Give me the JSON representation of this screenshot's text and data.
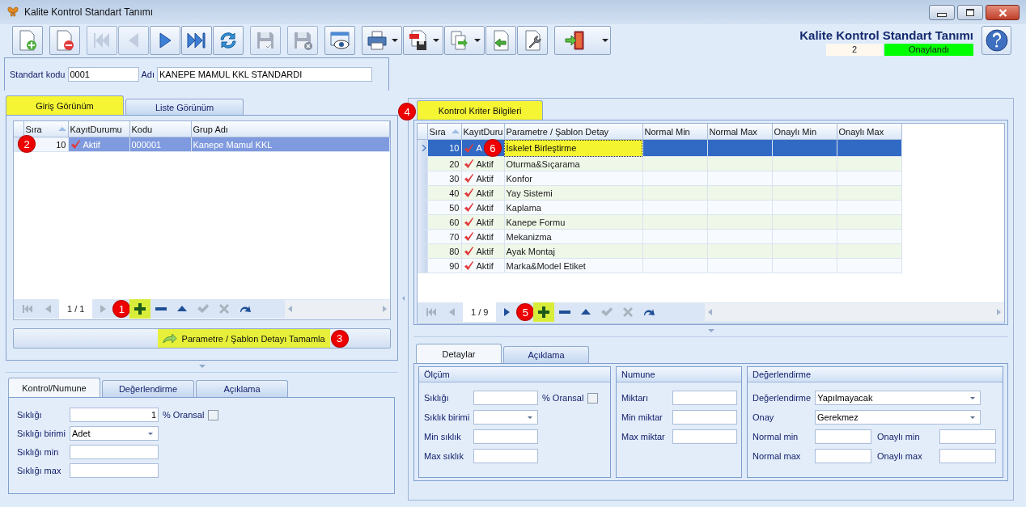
{
  "window": {
    "title": "Kalite Kontrol Standart Tanımı"
  },
  "toolbar": {
    "groups": [
      [
        {
          "kind": "new",
          "disabled": false
        }
      ],
      [
        {
          "kind": "delete",
          "disabled": false
        }
      ],
      [
        {
          "kind": "first",
          "disabled": true
        },
        {
          "kind": "prev",
          "disabled": true
        },
        {
          "kind": "next",
          "disabled": false
        },
        {
          "kind": "last",
          "disabled": false
        },
        {
          "kind": "refresh",
          "disabled": false
        }
      ],
      [
        {
          "kind": "save",
          "disabled": true
        }
      ],
      [
        {
          "kind": "discard",
          "disabled": true
        }
      ],
      [
        {
          "kind": "preview",
          "disabled": false
        }
      ],
      [
        {
          "kind": "print",
          "disabled": false,
          "dropdown": true
        },
        {
          "kind": "pdf",
          "disabled": false,
          "dropdown": true
        },
        {
          "kind": "export",
          "disabled": false,
          "dropdown": true
        },
        {
          "kind": "import",
          "disabled": false
        },
        {
          "kind": "tools",
          "disabled": false
        }
      ],
      [
        {
          "kind": "exit",
          "disabled": false,
          "dropdown": true
        }
      ]
    ]
  },
  "header": {
    "title": "Kalite Kontrol Standart Tanımı",
    "record_no": "2",
    "status": "Onaylandı"
  },
  "form": {
    "code_label": "Standart kodu",
    "code_value": "0001",
    "name_label": "Adı",
    "name_value": "KANEPE MAMUL KKL STANDARDI"
  },
  "left_tabs": [
    {
      "label": "Giriş Görünüm",
      "selected": true
    },
    {
      "label": "Liste Görünüm",
      "selected": false
    }
  ],
  "left_grid": {
    "columns": [
      "Sıra",
      "KayıtDurumu",
      "Kodu",
      "Grup Adı"
    ],
    "rows": [
      {
        "sira": "10",
        "status": "Aktif",
        "code": "000001",
        "group": "Kanepe Mamul KKL",
        "selected": true,
        "badge": "2"
      }
    ],
    "navigator": [
      {
        "kind": "first",
        "disabled": true
      },
      {
        "kind": "prev",
        "disabled": true
      },
      {
        "kind": "page",
        "label": "1 / 1"
      },
      {
        "kind": "next",
        "disabled": true
      },
      {
        "kind": "badge",
        "label": "1"
      },
      {
        "kind": "add",
        "disabled": false,
        "highlighted": true
      },
      {
        "kind": "remove",
        "disabled": false
      },
      {
        "kind": "up",
        "disabled": false
      },
      {
        "kind": "check",
        "disabled": true
      },
      {
        "kind": "cancel",
        "disabled": true
      },
      {
        "kind": "redo",
        "disabled": false
      }
    ]
  },
  "complete_button": {
    "label": "Parametre / Şablon Detayı Tamamla",
    "badge": "3"
  },
  "left_detail": {
    "tabs": [
      {
        "label": "Kontrol/Numune",
        "selected": true
      },
      {
        "label": "Değerlendirme",
        "selected": false
      },
      {
        "label": "Açıklama",
        "selected": false
      }
    ],
    "fields": [
      {
        "label": "Sıklığı",
        "kind": "number",
        "value": "1",
        "check": {
          "label": "% Oransal",
          "checked": false
        }
      },
      {
        "label": "Sıklığı birimi",
        "kind": "combo",
        "value": "Adet"
      },
      {
        "label": "Sıklığı min",
        "kind": "text"
      },
      {
        "label": "Sıklığı max",
        "kind": "text"
      }
    ]
  },
  "right_tab": {
    "label": "Kontrol Kriter Bilgileri",
    "badge": "4"
  },
  "right_grid": {
    "columns": [
      "Sıra",
      "KayıtDuru",
      "Parametre / Şablon Detay",
      "Normal Min",
      "Normal Max",
      "Onaylı Min",
      "Onaylı Max"
    ],
    "rows": [
      {
        "sira": "10",
        "status": "A",
        "param": "İskelet Birleştirme",
        "selected": true,
        "badge": "6"
      },
      {
        "sira": "20",
        "status": "Aktif",
        "param": "Oturma&Sıçarama",
        "selected": false
      },
      {
        "sira": "30",
        "status": "Aktif",
        "param": "Konfor",
        "selected": false
      },
      {
        "sira": "40",
        "status": "Aktif",
        "param": "Yay Sistemi",
        "selected": false
      },
      {
        "sira": "50",
        "status": "Aktif",
        "param": "Kaplama",
        "selected": false
      },
      {
        "sira": "60",
        "status": "Aktif",
        "param": "Kanepe Formu",
        "selected": false
      },
      {
        "sira": "70",
        "status": "Aktif",
        "param": "Mekanizma",
        "selected": false
      },
      {
        "sira": "80",
        "status": "Aktif",
        "param": "Ayak Montaj",
        "selected": false
      },
      {
        "sira": "90",
        "status": "Aktif",
        "param": "Marka&Model Etiket",
        "selected": false
      }
    ],
    "navigator": [
      {
        "kind": "first",
        "disabled": true
      },
      {
        "kind": "prev",
        "disabled": true
      },
      {
        "kind": "page",
        "label": "1 / 9"
      },
      {
        "kind": "next",
        "disabled": false
      },
      {
        "kind": "badge",
        "label": "5"
      },
      {
        "kind": "add",
        "disabled": false,
        "highlighted": true
      },
      {
        "kind": "remove",
        "disabled": false
      },
      {
        "kind": "up",
        "disabled": false
      },
      {
        "kind": "check",
        "disabled": true
      },
      {
        "kind": "cancel",
        "disabled": true
      },
      {
        "kind": "redo",
        "disabled": false
      }
    ]
  },
  "right_detail": {
    "tabs": [
      {
        "label": "Detaylar",
        "selected": true
      },
      {
        "label": "Açıklama",
        "selected": false
      }
    ],
    "groups": [
      {
        "title": "Ölçüm",
        "rows": [
          {
            "kind": "text",
            "label": "Sıklığı",
            "check": {
              "label": "% Oransal",
              "checked": false
            }
          },
          {
            "kind": "combo",
            "label": "Sıklık birimi"
          },
          {
            "kind": "text",
            "label": "Min sıklık"
          },
          {
            "kind": "text",
            "label": "Max sıklık"
          }
        ]
      },
      {
        "title": "Numune",
        "rows": [
          {
            "kind": "text",
            "label": "Miktarı"
          },
          {
            "kind": "text",
            "label": "Min miktar"
          },
          {
            "kind": "text",
            "label": "Max miktar"
          }
        ]
      },
      {
        "title": "Değerlendirme",
        "rows": [
          {
            "kind": "combo",
            "label": "Değerlendirme",
            "value": "Yapılmayacak",
            "wide": true
          },
          {
            "kind": "combo",
            "label": "Onay",
            "value": "Gerekmez",
            "wide": true
          },
          {
            "kind": "pair",
            "items": [
              {
                "label": "Normal min"
              },
              {
                "label": "Onaylı min"
              }
            ]
          },
          {
            "kind": "pair",
            "items": [
              {
                "label": "Normal max"
              },
              {
                "label": "Onaylı max"
              }
            ]
          }
        ]
      }
    ]
  }
}
